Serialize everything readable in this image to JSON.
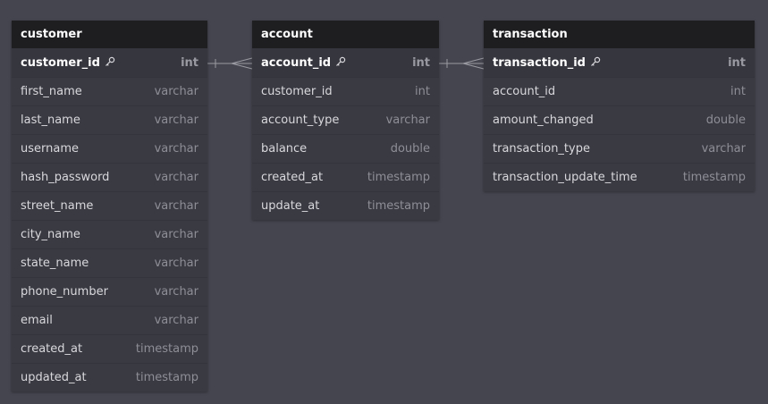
{
  "colors": {
    "canvas": "#45454f",
    "table_body": "#3a3a43",
    "table_header": "#1e1e21",
    "header_text": "#ffffff",
    "column_text": "#d8d8dc",
    "type_text": "#8e8e97",
    "connector": "#9a9aa2"
  },
  "tables": {
    "customer": {
      "name": "customer",
      "columns": [
        {
          "name": "customer_id",
          "type": "int",
          "pk": true
        },
        {
          "name": "first_name",
          "type": "varchar"
        },
        {
          "name": "last_name",
          "type": "varchar"
        },
        {
          "name": "username",
          "type": "varchar"
        },
        {
          "name": "hash_password",
          "type": "varchar"
        },
        {
          "name": "street_name",
          "type": "varchar"
        },
        {
          "name": "city_name",
          "type": "varchar"
        },
        {
          "name": "state_name",
          "type": "varchar"
        },
        {
          "name": "phone_number",
          "type": "varchar"
        },
        {
          "name": "email",
          "type": "varchar"
        },
        {
          "name": "created_at",
          "type": "timestamp"
        },
        {
          "name": "updated_at",
          "type": "timestamp"
        }
      ]
    },
    "account": {
      "name": "account",
      "columns": [
        {
          "name": "account_id",
          "type": "int",
          "pk": true
        },
        {
          "name": "customer_id",
          "type": "int"
        },
        {
          "name": "account_type",
          "type": "varchar"
        },
        {
          "name": "balance",
          "type": "double"
        },
        {
          "name": "created_at",
          "type": "timestamp"
        },
        {
          "name": "update_at",
          "type": "timestamp"
        }
      ]
    },
    "transaction": {
      "name": "transaction",
      "columns": [
        {
          "name": "transaction_id",
          "type": "int",
          "pk": true
        },
        {
          "name": "account_id",
          "type": "int"
        },
        {
          "name": "amount_changed",
          "type": "double"
        },
        {
          "name": "transaction_type",
          "type": "varchar"
        },
        {
          "name": "transaction_update_time",
          "type": "timestamp"
        }
      ]
    }
  },
  "relationships": [
    {
      "from": "customer.customer_id",
      "to": "account.account_id",
      "from_end": "one",
      "to_end": "many"
    },
    {
      "from": "account.account_id",
      "to": "transaction.transaction_id",
      "from_end": "one",
      "to_end": "many"
    }
  ]
}
